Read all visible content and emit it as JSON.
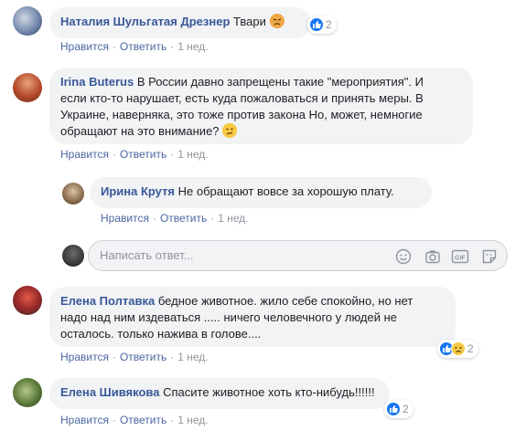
{
  "colors": {
    "author": "#385898",
    "meta_link": "#4b67a1",
    "bubble": "#f2f3f5",
    "like_blue": "#1877f2"
  },
  "actions": {
    "like": "Нравится",
    "reply": "Ответить"
  },
  "reply_box": {
    "placeholder": "Написать ответ..."
  },
  "comments": [
    {
      "author": "Наталия Шульгатая Дрезнер",
      "text": "Твари",
      "time": "1 нед.",
      "reactions": [
        "like"
      ],
      "count": "2"
    },
    {
      "author": "Irina Buterus",
      "text_lines": [
        "В России давно запрещены такие \"мероприятия\". И",
        "если кто-то нарушает, есть куда пожаловаться и принять меры. В",
        "Украине, наверняка, это тоже против закона Но, может, немногие",
        "обращают на это внимание?"
      ],
      "time": "1 нед."
    },
    {
      "author": "Ирина Крутя",
      "text": "Не обращают вовсе за хорошую плату.",
      "time": "1 нед."
    },
    {
      "author": "Елена Полтавка",
      "text_lines": [
        "бедное животное. жило себе спокойно, но нет",
        "надо над ним издеваться ..... ничего человечного у людей не",
        "осталось. только нажива в голове...."
      ],
      "time": "1 нед.",
      "reactions": [
        "like",
        "sad"
      ],
      "count": "2"
    },
    {
      "author": "Елена Шивякова",
      "text": "Спасите животное хоть кто-нибудь!!!!!!",
      "time": "1 нед.",
      "reactions": [
        "like"
      ],
      "count": "2"
    }
  ]
}
